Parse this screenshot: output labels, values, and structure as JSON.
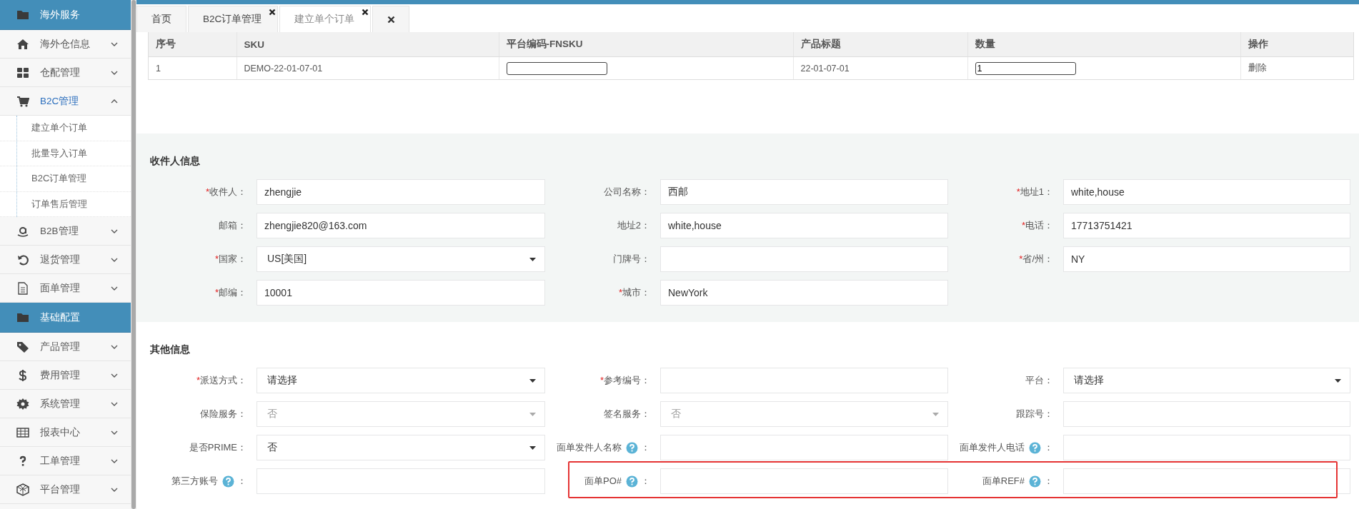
{
  "sidebar": {
    "items": [
      {
        "kind": "section",
        "label": "海外服务"
      },
      {
        "kind": "menu",
        "label": "海外仓信息",
        "expanded": false
      },
      {
        "kind": "menu",
        "label": "仓配管理",
        "expanded": false
      },
      {
        "kind": "menu",
        "label": "B2C管理",
        "expanded": true,
        "children": [
          {
            "label": "建立单个订单"
          },
          {
            "label": "批量导入订单"
          },
          {
            "label": "B2C订单管理"
          },
          {
            "label": "订单售后管理"
          }
        ]
      },
      {
        "kind": "menu",
        "label": "B2B管理",
        "expanded": false
      },
      {
        "kind": "menu",
        "label": "退货管理",
        "expanded": false
      },
      {
        "kind": "menu",
        "label": "面单管理",
        "expanded": false
      },
      {
        "kind": "section",
        "label": "基础配置"
      },
      {
        "kind": "menu",
        "label": "产品管理",
        "expanded": false
      },
      {
        "kind": "menu",
        "label": "费用管理",
        "expanded": false
      },
      {
        "kind": "menu",
        "label": "系统管理",
        "expanded": false
      },
      {
        "kind": "menu",
        "label": "报表中心",
        "expanded": false
      },
      {
        "kind": "menu",
        "label": "工单管理",
        "expanded": false
      },
      {
        "kind": "menu",
        "label": "平台管理",
        "expanded": false
      }
    ]
  },
  "tabs": [
    {
      "kind": "page",
      "label": "首页",
      "selected": false,
      "closable": false
    },
    {
      "kind": "page",
      "label": "B2C订单管理",
      "selected": false,
      "closable": true
    },
    {
      "kind": "page",
      "label": "建立单个订单",
      "selected": true,
      "closable": true
    },
    {
      "kind": "close-all"
    }
  ],
  "order_table": {
    "columns": [
      "序号",
      "SKU",
      "平台编码-FNSKU",
      "产品标题",
      "数量",
      "操作"
    ],
    "rows": [
      {
        "cells": [
          {
            "kind": "text",
            "text": "1"
          },
          {
            "kind": "text",
            "text": "DEMO-22-01-07-01"
          },
          {
            "kind": "input"
          },
          {
            "kind": "text",
            "text": "22-01-07-01"
          },
          {
            "kind": "input",
            "value": "1"
          },
          {
            "kind": "link",
            "text": "删除"
          }
        ]
      }
    ]
  },
  "recipient": {
    "title": "收件人信息",
    "fields": [
      {
        "label": "收件人",
        "mark": "*",
        "colon": "：",
        "kind": "text",
        "value": "zhengjie",
        "help": false,
        "disabled": false
      },
      {
        "label": "公司名称",
        "colon": "：",
        "kind": "text",
        "value": "西邮",
        "help": false,
        "disabled": false
      },
      {
        "label": "地址1",
        "mark": "*",
        "colon": "：",
        "kind": "text",
        "value": "white,house",
        "help": false,
        "disabled": false
      },
      {
        "label": "邮箱",
        "colon": "：",
        "kind": "text",
        "value": "zhengjie820@163.com",
        "help": false,
        "disabled": false
      },
      {
        "label": "地址2",
        "colon": "：",
        "kind": "text",
        "value": "white,house",
        "help": false,
        "disabled": false
      },
      {
        "label": "电话",
        "mark": "*",
        "colon": "：",
        "kind": "text",
        "value": "17713751421",
        "help": false,
        "disabled": false
      },
      {
        "label": "国家",
        "mark": "*",
        "colon": "：",
        "kind": "select",
        "value": "US[美国]",
        "help": false,
        "disabled": false
      },
      {
        "label": "门牌号",
        "colon": "：",
        "kind": "text",
        "help": false,
        "disabled": false
      },
      {
        "label": "省/州",
        "mark": "*",
        "colon": "：",
        "kind": "text",
        "value": "NY",
        "help": false,
        "disabled": false
      },
      {
        "label": "邮编",
        "mark": "*",
        "colon": "：",
        "kind": "text",
        "value": "10001",
        "help": false,
        "disabled": false
      },
      {
        "label": "城市",
        "mark": "*",
        "colon": "：",
        "kind": "text",
        "value": "NewYork",
        "help": false,
        "disabled": false
      }
    ]
  },
  "other": {
    "title": "其他信息",
    "fields": [
      {
        "label": "派送方式",
        "mark": "*",
        "colon": "：",
        "kind": "select",
        "value": "请选择",
        "help": false,
        "disabled": false
      },
      {
        "label": "参考编号",
        "mark": "*",
        "colon": "：",
        "kind": "text",
        "help": false,
        "disabled": false
      },
      {
        "label": "平台",
        "colon": "：",
        "kind": "select",
        "value": "请选择",
        "help": false,
        "disabled": false
      },
      {
        "label": "保险服务",
        "colon": "：",
        "kind": "select",
        "value": "否",
        "help": false,
        "disabled": true
      },
      {
        "label": "签名服务",
        "colon": "：",
        "kind": "select",
        "value": "否",
        "help": false,
        "disabled": true
      },
      {
        "label": "跟踪号",
        "colon": "：",
        "kind": "text",
        "help": false,
        "disabled": false
      },
      {
        "label": "是否PRIME",
        "colon": "：",
        "kind": "select",
        "value": "否",
        "help": false,
        "disabled": false
      },
      {
        "label": "面单发件人名称",
        "colon": "：",
        "kind": "text",
        "help": true,
        "disabled": false
      },
      {
        "label": "面单发件人电话",
        "colon": "：",
        "kind": "text",
        "help": true,
        "disabled": false
      },
      {
        "label": "第三方账号",
        "colon": "：",
        "kind": "text",
        "help": true,
        "disabled": false
      },
      {
        "label": "面单PO#",
        "colon": "：",
        "kind": "text",
        "help": true,
        "disabled": false,
        "highlighted": true
      },
      {
        "label": "面单REF#",
        "colon": "：",
        "kind": "text",
        "help": true,
        "disabled": false,
        "highlighted": true
      }
    ]
  }
}
